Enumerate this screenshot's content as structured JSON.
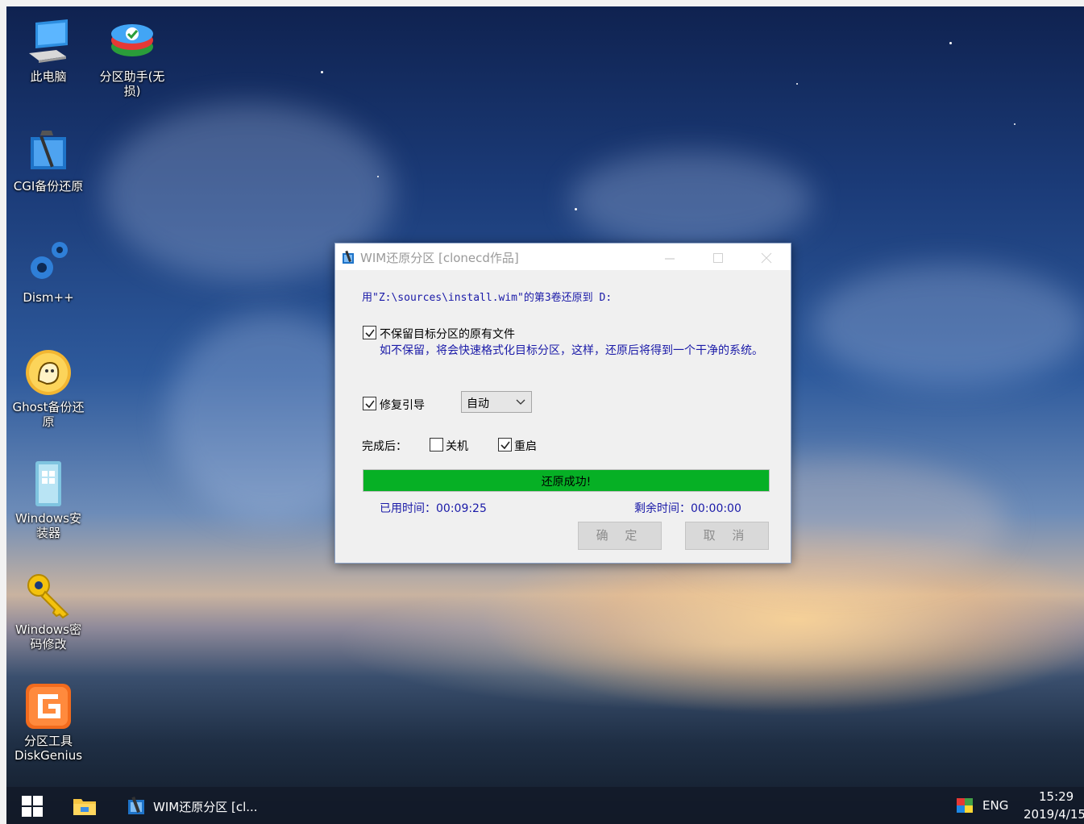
{
  "desktop_icons": [
    {
      "name": "this-pc",
      "label": "此电脑"
    },
    {
      "name": "partition-assistant",
      "label": "分区助手(无\n损)"
    },
    {
      "name": "cgi-backup",
      "label": "CGI备份还原"
    },
    {
      "name": "dism",
      "label": "Dism++"
    },
    {
      "name": "ghost-backup",
      "label": "Ghost备份还\n原"
    },
    {
      "name": "windows-installer",
      "label": "Windows安\n装器"
    },
    {
      "name": "windows-password",
      "label": "Windows密\n码修改"
    },
    {
      "name": "diskgenius",
      "label": "分区工具\nDiskGenius"
    }
  ],
  "dialog": {
    "title": "WIM还原分区  [clonecd作品]",
    "info": "用\"Z:\\sources\\install.wim\"的第3卷还原到 D:",
    "option_keep": {
      "label": "不保留目标分区的原有文件",
      "checked": true
    },
    "keep_note": "如不保留，将会快速格式化目标分区，这样，还原后将得到一个干净的系统。",
    "option_repair": {
      "label": "修复引导",
      "checked": true
    },
    "boot_select": "自动",
    "after_label": "完成后：",
    "shutdown": {
      "label": "关机",
      "checked": false
    },
    "restart": {
      "label": "重启",
      "checked": true
    },
    "progress_percent": 100,
    "progress_text": "还原成功!",
    "elapsed": "已用时间：00:09:25",
    "remaining": "剩余时间：00:00:00",
    "ok_label": "确 定",
    "cancel_label": "取 消"
  },
  "taskbar": {
    "task_label": "WIM还原分区  [cl...",
    "lang": "ENG",
    "time": "15:29",
    "date": "2019/4/15"
  },
  "colors": {
    "progress_fill": "#06b025",
    "info_text": "#1a1aa8"
  }
}
